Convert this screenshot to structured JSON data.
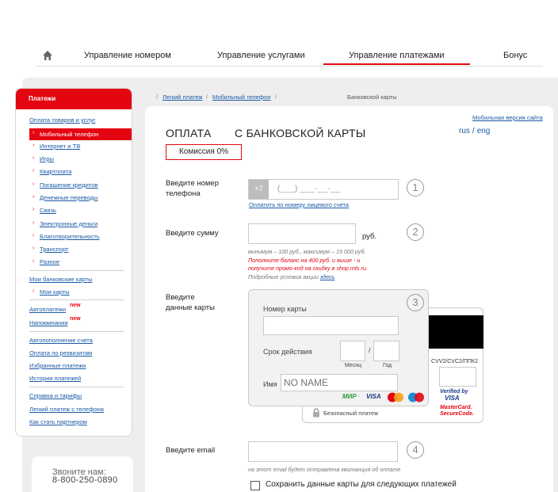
{
  "topnav": {
    "home_icon": "home-icon",
    "items": [
      "Управление номером",
      "Управление услугами",
      "Управление платежами",
      "Бонус"
    ],
    "active_index": 2
  },
  "sidebar": {
    "header": "Платежи",
    "goods": "Оплата товаров и услуг",
    "active": "Мобильный телефон",
    "subitems": [
      "Интернет и ТВ",
      "Игры",
      "Квартплата",
      "Погашение кредитов",
      "Денежные переводы",
      "Связь",
      "Электронные деньги",
      "Благотворительность",
      "Транспорт",
      "Разное"
    ],
    "bank_cards": "Мои банковские карты",
    "my_cards": "Мои карты",
    "autopay": "Автоплатежи",
    "reminders": "Напоминания",
    "new_badge": "new",
    "links2": [
      "Автопополнение счета",
      "Оплата по реквизитам",
      "Избранные платежи",
      "История платежей"
    ],
    "links3": [
      "Справка и тарифы",
      "Легкий платеж с телефона",
      "Как стать партнером"
    ],
    "call_title": "Звоните нам:",
    "call_phone": "8-800-250-0890"
  },
  "breadcrumb": {
    "items": [
      "Легкий платеж",
      "Мобильный телефон",
      "Банковской карты"
    ],
    "separator": "/"
  },
  "header": {
    "mobile_version": "Мобильная версия сайта",
    "lang_ru": "rus",
    "lang_en": "eng",
    "title_left": "ОПЛАТА",
    "title_right": "С БАНКОВСКОЙ КАРТЫ",
    "commission": "Комиссия 0%"
  },
  "form": {
    "phone": {
      "label_line1": "Введите номер",
      "label_line2": "телефона",
      "prefix": "+7",
      "mask": "(___) ___-__-__",
      "account_link": "Оплатить по номеру лицевого счета",
      "step": "1"
    },
    "amount": {
      "label": "Введите сумму",
      "unit": "руб.",
      "step": "2",
      "limits": "минимум – 100 руб., максимум – 15 000 руб.",
      "promo_line1": "Пополните баланс на 400 руб. и выше - и",
      "promo_line2": "получите промо-код на скидку в shop.mts.ru.",
      "details_text": "Подробные условия акции",
      "details_link": "здесь"
    },
    "card": {
      "label_line1": "Введите",
      "label_line2": "данные карты",
      "step": "3",
      "number_label": "Номер карты",
      "expiry_label": "Срок действия",
      "month": "Месяц",
      "year": "Год",
      "slash": "/",
      "name_label": "Имя",
      "name_placeholder": "NO NAME",
      "cvv_label": "CVV2/CVC2/ППК2",
      "secure_payment": "Безопасный платеж",
      "verified_line1": "Verified by",
      "verified_line2": "VISA",
      "mc_line1": "MasterCard.",
      "mc_line2": "SecureCode.",
      "logo_mir": "МИР",
      "logo_visa": "VISA",
      "icons": [
        "lock-icon",
        "mir-logo",
        "visa-logo",
        "mastercard-logo",
        "maestro-logo"
      ]
    },
    "email": {
      "label": "Введите email",
      "step": "4",
      "hint": "на этот email будет отправлена квитанция об оплате"
    },
    "save_card": {
      "label": "Сохранить данные карты для следующих платежей",
      "checked": false
    }
  },
  "colors": {
    "accent": "#e30611",
    "link": "#1a5aa6",
    "frame": "#eeeeee"
  }
}
